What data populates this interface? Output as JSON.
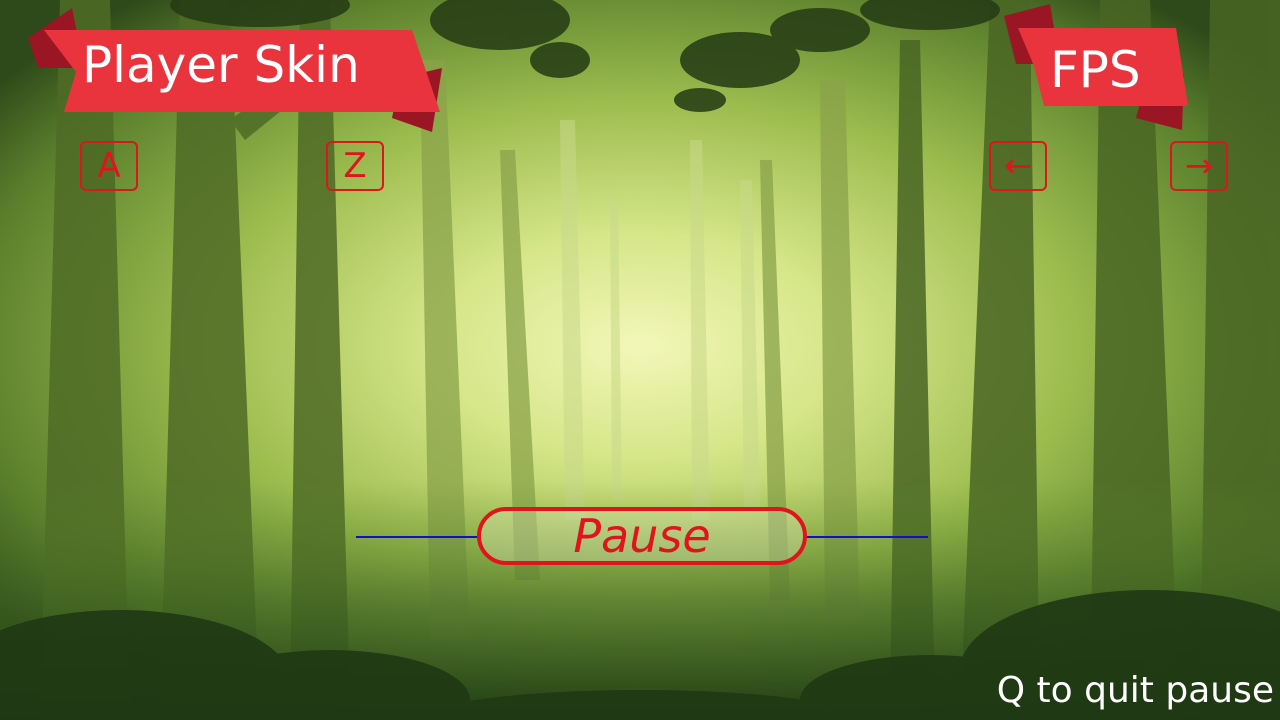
{
  "hud": {
    "skin_banner": {
      "label": "Player Skin"
    },
    "fps_banner": {
      "label": "FPS"
    },
    "skin_keys": {
      "prev": "A",
      "next": "Z"
    },
    "fps_keys": {
      "decrease": "←",
      "increase": "→"
    },
    "pause": {
      "label": "Pause"
    },
    "quit_hint": "Q to quit pause"
  },
  "colors": {
    "banner_red": "#e9343e",
    "banner_fold": "#9a1624",
    "key_red": "#e0141c",
    "line_blue": "#1010cc",
    "text_white": "#ffffff"
  },
  "icons": {
    "decrease": "left-arrow-icon",
    "increase": "right-arrow-icon"
  }
}
